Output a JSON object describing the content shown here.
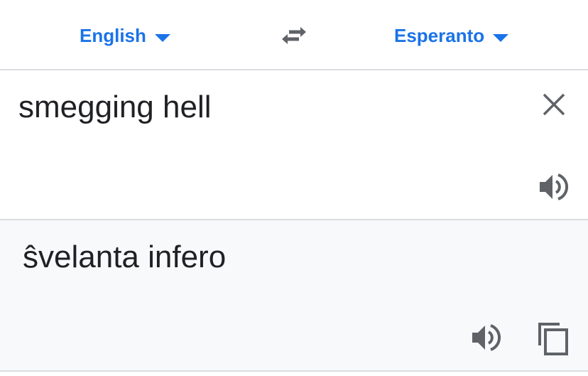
{
  "colors": {
    "accent": "#1a73e8",
    "icon": "#5f6368",
    "text": "#202124",
    "divider": "#dadce0",
    "output_bg": "#f8f9fa"
  },
  "language_bar": {
    "source_language": "English",
    "target_language": "Esperanto",
    "swap_icon": "swap-horiz-icon"
  },
  "input": {
    "text": "smegging hell",
    "clear_icon": "close-icon",
    "speaker_icon": "speaker-icon"
  },
  "output": {
    "text": "ŝvelanta infero",
    "speaker_icon": "speaker-icon",
    "copy_icon": "copy-icon"
  }
}
